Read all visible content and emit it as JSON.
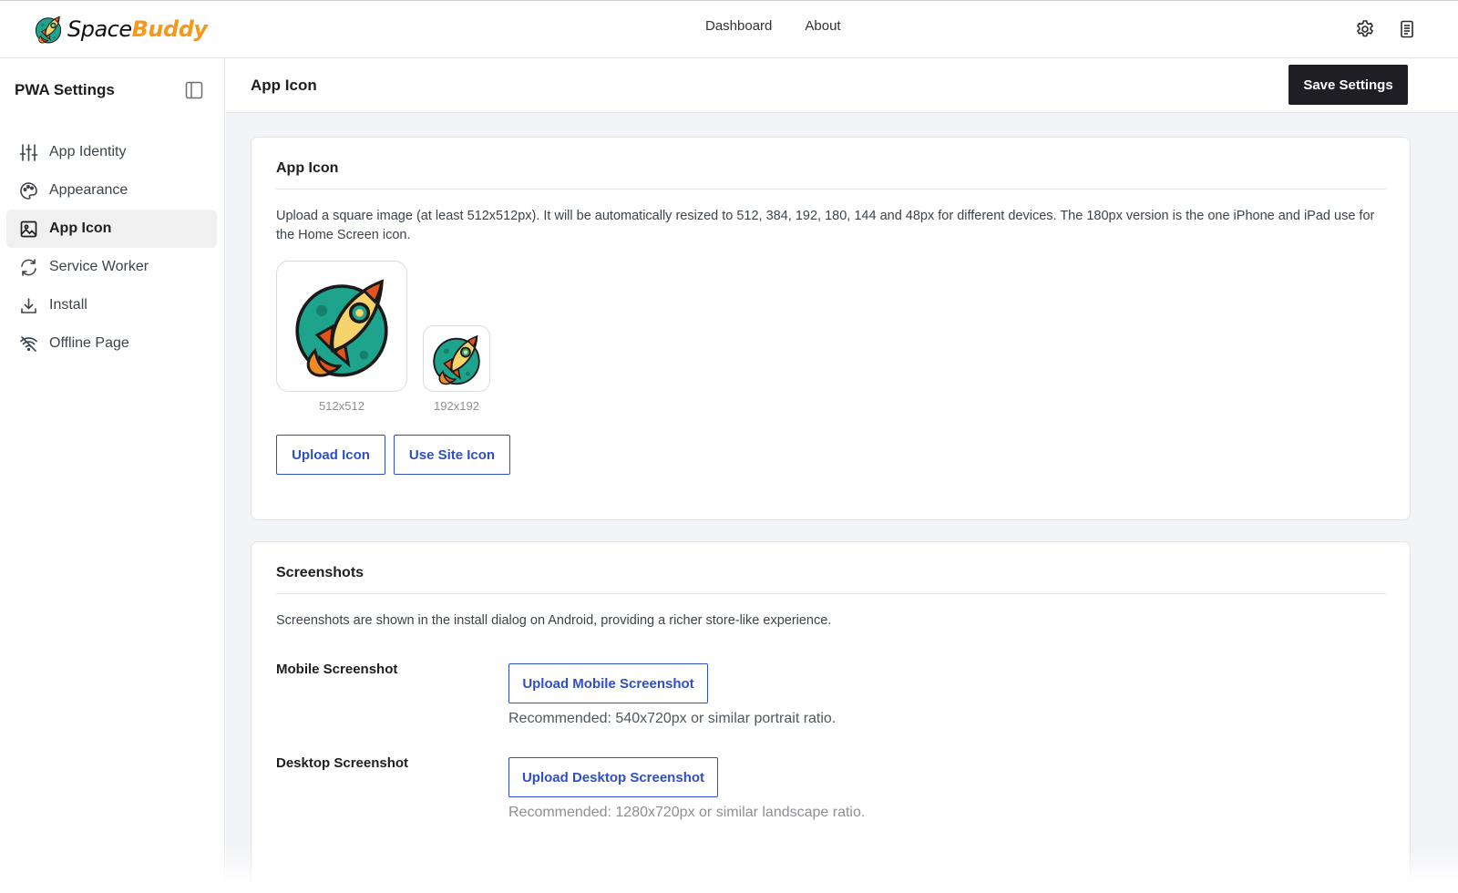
{
  "brand": {
    "name_part1": "Space",
    "name_part2": "Buddy",
    "accent": "#f39a1e"
  },
  "topnav": {
    "items": [
      "Dashboard",
      "About"
    ]
  },
  "top_actions": {
    "icons": [
      "gear-icon",
      "document-icon"
    ]
  },
  "sidebar": {
    "title": "PWA Settings",
    "items": [
      {
        "label": "App Identity",
        "icon": "sliders-icon"
      },
      {
        "label": "Appearance",
        "icon": "palette-icon"
      },
      {
        "label": "App Icon",
        "icon": "image-icon",
        "active": true
      },
      {
        "label": "Service Worker",
        "icon": "refresh-icon"
      },
      {
        "label": "Install",
        "icon": "download-icon"
      },
      {
        "label": "Offline Page",
        "icon": "wifi-off-icon"
      }
    ]
  },
  "header": {
    "title": "App Icon",
    "save_label": "Save Settings"
  },
  "app_icon_card": {
    "title": "App Icon",
    "description": "Upload a square image (at least 512x512px). It will be automatically resized to 512, 384, 192, 180, 144 and 48px for different devices. The 180px version is the one iPhone and iPad use for the Home Screen icon.",
    "previews": [
      {
        "caption": "512x512"
      },
      {
        "caption": "192x192"
      }
    ],
    "upload_label": "Upload Icon",
    "site_icon_label": "Use Site Icon"
  },
  "screenshots_card": {
    "title": "Screenshots",
    "description": "Screenshots are shown in the install dialog on Android, providing a richer store-like experience.",
    "mobile": {
      "label": "Mobile Screenshot",
      "button": "Upload Mobile Screenshot",
      "hint": "Recommended: 540x720px or similar portrait ratio."
    },
    "desktop": {
      "label": "Desktop Screenshot",
      "button": "Upload Desktop Screenshot",
      "hint": "Recommended: 1280x720px or similar landscape ratio."
    }
  },
  "colors": {
    "primary_button": "#1e1e24",
    "link_blue": "#2f4fc4",
    "background": "#f3f4f7"
  }
}
